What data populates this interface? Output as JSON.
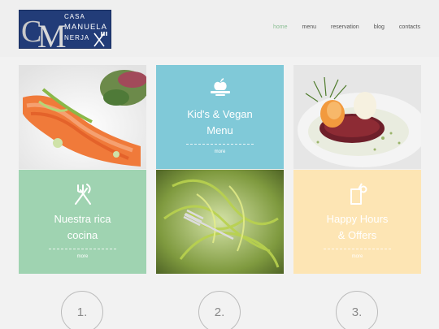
{
  "logo": {
    "initials": "CM",
    "line1": "CASA",
    "line2": "MANUELA",
    "line3": "NERJA"
  },
  "nav": {
    "items": [
      "home",
      "menu",
      "reservation",
      "blog",
      "contacts"
    ],
    "active": "home"
  },
  "cards": {
    "kids_vegan": {
      "title_line1": "Kid's & Vegan",
      "title_line2": "Menu",
      "more": "more",
      "bg": "#80c9d8"
    },
    "nuestra": {
      "title_line1": "Nuestra rica",
      "title_line2": "cocina",
      "more": "more",
      "bg": "#9fd3b1"
    },
    "happy": {
      "title_line1": "Happy Hours",
      "title_line2": "& Offers",
      "more": "more",
      "bg": "#fde5b4"
    }
  },
  "steps": [
    "1.",
    "2.",
    "3."
  ]
}
